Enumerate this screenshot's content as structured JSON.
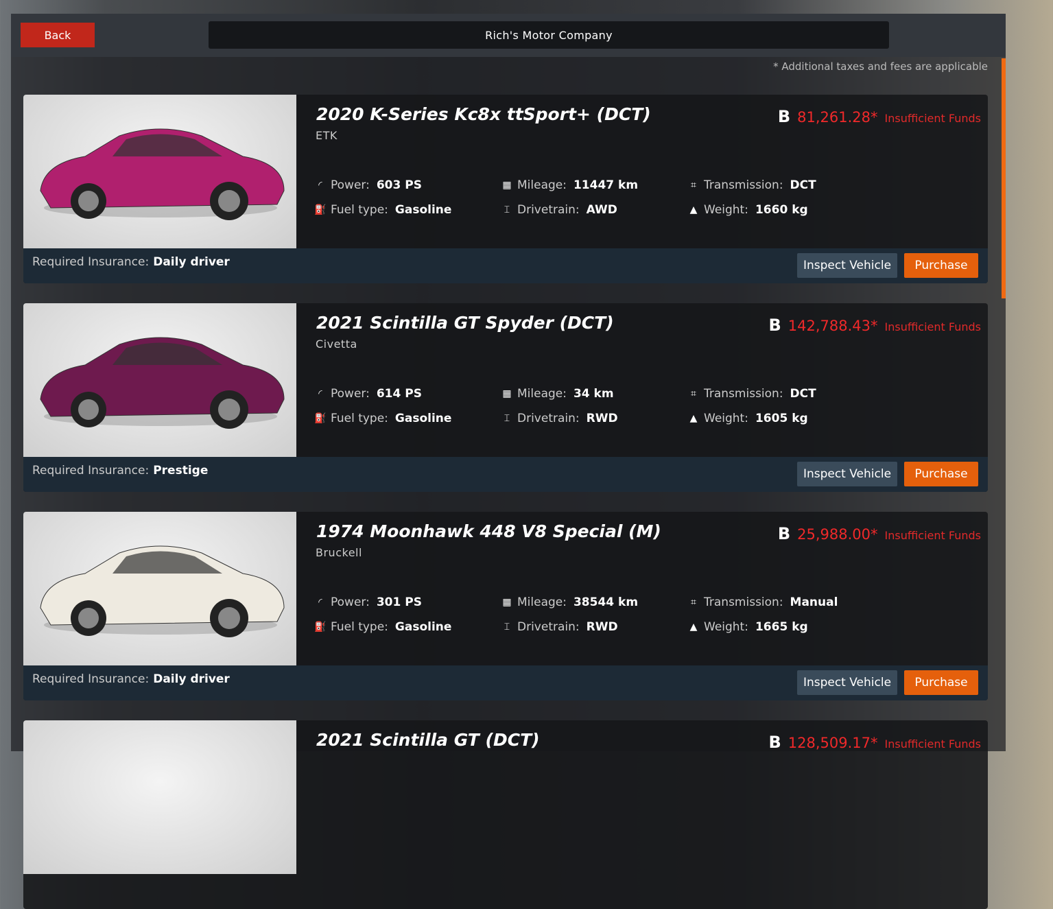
{
  "header": {
    "back_label": "Back",
    "title": "Rich's Motor Company",
    "note": "* Additional taxes and fees are applicable"
  },
  "labels": {
    "power": "Power:",
    "mileage": "Mileage:",
    "transmission": "Transmission:",
    "fuel": "Fuel type:",
    "drivetrain": "Drivetrain:",
    "weight": "Weight:",
    "insurance": "Required Insurance:",
    "inspect": "Inspect Vehicle",
    "purchase": "Purchase",
    "insufficient": "Insufficient Funds",
    "currency_symbol": "B"
  },
  "colors": {
    "accent": "#e5600c",
    "error": "#f0292a"
  },
  "vehicles": [
    {
      "name": "2020 K-Series Kc8x ttSport+ (DCT)",
      "brand": "ETK",
      "price": "81,261.28*",
      "power": "603 PS",
      "mileage": "11447 km",
      "transmission": "DCT",
      "fuel": "Gasoline",
      "drivetrain": "AWD",
      "weight": "1660 kg",
      "insurance": "Daily driver",
      "color": "#b0206e"
    },
    {
      "name": "2021 Scintilla GT Spyder (DCT)",
      "brand": "Civetta",
      "price": "142,788.43*",
      "power": "614 PS",
      "mileage": "34 km",
      "transmission": "DCT",
      "fuel": "Gasoline",
      "drivetrain": "RWD",
      "weight": "1605 kg",
      "insurance": "Prestige",
      "color": "#6e1a4e"
    },
    {
      "name": "1974 Moonhawk 448 V8 Special (M)",
      "brand": "Bruckell",
      "price": "25,988.00*",
      "power": "301 PS",
      "mileage": "38544 km",
      "transmission": "Manual",
      "fuel": "Gasoline",
      "drivetrain": "RWD",
      "weight": "1665 kg",
      "insurance": "Daily driver",
      "color": "#eeeae0"
    },
    {
      "name": "2021 Scintilla GT (DCT)",
      "price": "128,509.17*"
    }
  ]
}
